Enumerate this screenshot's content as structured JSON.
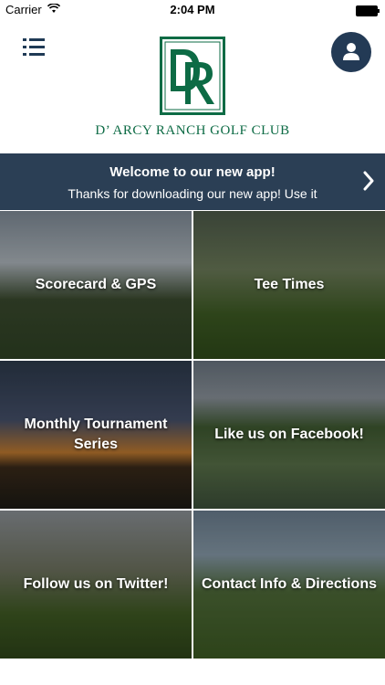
{
  "status_bar": {
    "carrier": "Carrier",
    "time": "2:04 PM"
  },
  "header": {
    "club_name": "D’ ARCY RANCH GOLF CLUB",
    "logo_letters": "DR",
    "menu_icon": "menu-list-icon",
    "profile_icon": "person-icon"
  },
  "banner": {
    "title": "Welcome to our new app!",
    "message": "Thanks for downloading our new app! Use it"
  },
  "tiles": [
    {
      "label": "Scorecard & GPS"
    },
    {
      "label": "Tee Times"
    },
    {
      "label": "Monthly Tournament Series"
    },
    {
      "label": "Like us on Facebook!"
    },
    {
      "label": "Follow us on Twitter!"
    },
    {
      "label": "Contact Info & Directions"
    }
  ],
  "colors": {
    "brand_green": "#0d6b45",
    "banner_bg": "#2b3f55",
    "profile_bg": "#233a55"
  }
}
